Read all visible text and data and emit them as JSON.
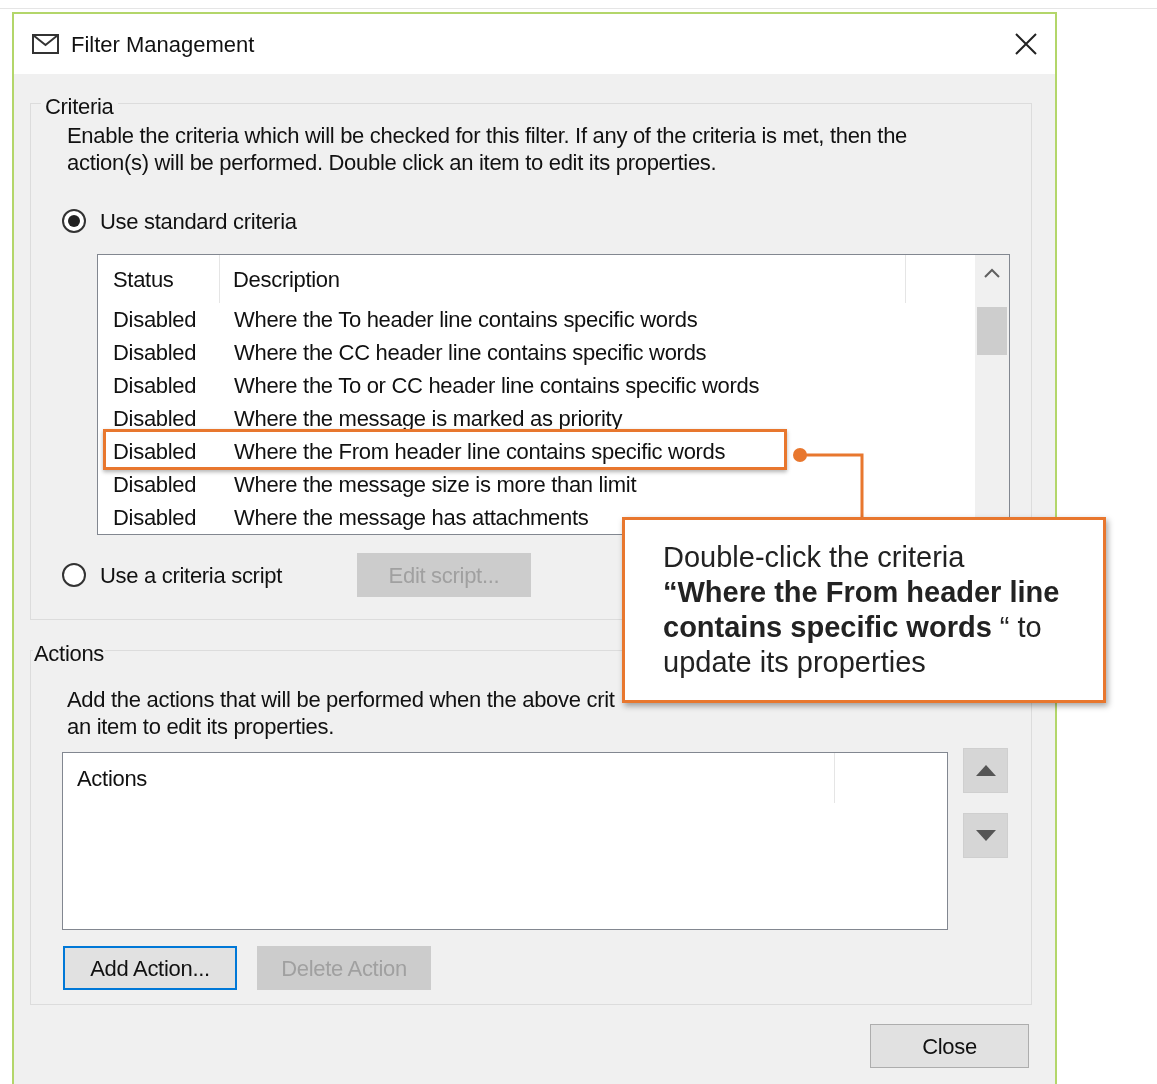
{
  "window": {
    "title": "Filter Management"
  },
  "criteria": {
    "legend": "Criteria",
    "description": "Enable the criteria which will be checked for this filter. If any of the criteria is met, then the\naction(s) will be performed. Double click an item to edit its properties.",
    "options": [
      {
        "label": "Use standard criteria",
        "selected": true
      },
      {
        "label": "Use a criteria script",
        "selected": false
      }
    ],
    "list": {
      "columns": [
        "Status",
        "Description"
      ],
      "rows": [
        {
          "status": "Disabled",
          "description": "Where the To header line contains specific words",
          "highlighted": false
        },
        {
          "status": "Disabled",
          "description": "Where the CC header line contains specific words",
          "highlighted": false
        },
        {
          "status": "Disabled",
          "description": "Where the To or CC header line contains specific words",
          "highlighted": false
        },
        {
          "status": "Disabled",
          "description": "Where the message is marked as priority",
          "highlighted": false
        },
        {
          "status": "Disabled",
          "description": "Where the From header line contains specific words",
          "highlighted": true
        },
        {
          "status": "Disabled",
          "description": "Where the message size is more than limit",
          "highlighted": false
        },
        {
          "status": "Disabled",
          "description": "Where the message has attachments",
          "highlighted": false
        }
      ]
    },
    "edit_script_button": {
      "label": "Edit script...",
      "disabled": true
    }
  },
  "actions": {
    "legend": "Actions",
    "description_lines": [
      "Add the actions that will be performed when the above crit",
      "an item to edit its properties."
    ],
    "list": {
      "columns": [
        "Actions"
      ]
    },
    "buttons": [
      {
        "label": "Add Action...",
        "disabled": false,
        "focused": true
      },
      {
        "label": "Delete Action",
        "disabled": true,
        "focused": false
      }
    ]
  },
  "close_button": {
    "label": "Close"
  },
  "callout": {
    "text": "Double-click the criteria\n**“Where the From header line**\n**contains specific words** “ to\nupdate its properties"
  }
}
